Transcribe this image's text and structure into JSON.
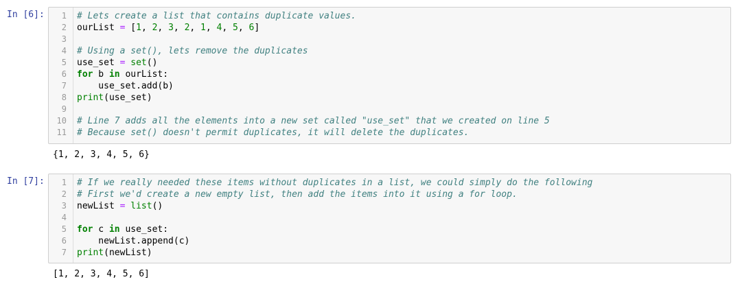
{
  "cells": [
    {
      "prompt": "In [6]:",
      "lines": [
        {
          "n": "1",
          "text": "# Lets create a list that contains duplicate values."
        },
        {
          "n": "2",
          "text": "ourList = [1, 2, 3, 2, 1, 4, 5, 6]"
        },
        {
          "n": "3",
          "text": ""
        },
        {
          "n": "4",
          "text": "# Using a set(), lets remove the duplicates"
        },
        {
          "n": "5",
          "text": "use_set = set()"
        },
        {
          "n": "6",
          "text": "for b in ourList:"
        },
        {
          "n": "7",
          "text": "    use_set.add(b)"
        },
        {
          "n": "8",
          "text": "print(use_set)"
        },
        {
          "n": "9",
          "text": ""
        },
        {
          "n": "10",
          "text": "# Line 7 adds all the elements into a new set called \"use_set\" that we created on line 5"
        },
        {
          "n": "11",
          "text": "# Because set() doesn't permit duplicates, it will delete the duplicates."
        }
      ],
      "output": "{1, 2, 3, 4, 5, 6}"
    },
    {
      "prompt": "In [7]:",
      "lines": [
        {
          "n": "1",
          "text": "# If we really needed these items without duplicates in a list, we could simply do the following"
        },
        {
          "n": "2",
          "text": "# First we'd create a new empty list, then add the items into it using a for loop."
        },
        {
          "n": "3",
          "text": "newList = list()"
        },
        {
          "n": "4",
          "text": ""
        },
        {
          "n": "5",
          "text": "for c in use_set:"
        },
        {
          "n": "6",
          "text": "    newList.append(c)"
        },
        {
          "n": "7",
          "text": "print(newList)"
        }
      ],
      "output": "[1, 2, 3, 4, 5, 6]"
    }
  ]
}
